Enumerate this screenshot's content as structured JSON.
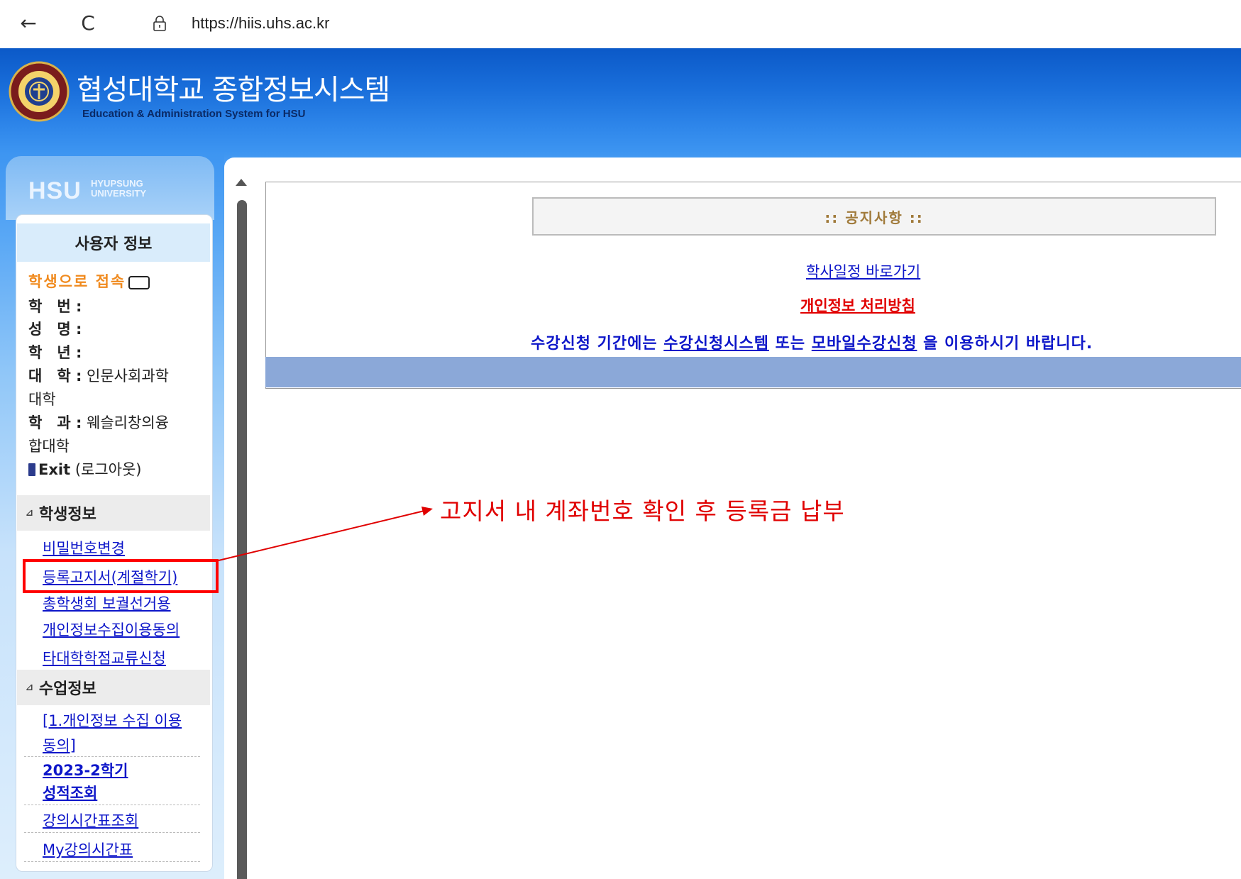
{
  "browser": {
    "url": "https://hiis.uhs.ac.kr",
    "back_icon": "←",
    "reload_icon": "C"
  },
  "header": {
    "title": "협성대학교 종합정보시스템",
    "subtitle": "Education & Administration System for HSU",
    "colors": {
      "primary": "#1a6fdb",
      "subtitle": "#0a2a66"
    }
  },
  "sidebar": {
    "hsu_logo": {
      "main": "HSU",
      "line1": "HYUPSUNG",
      "line2": "UNIVERSITY"
    },
    "user_info": {
      "heading": "사용자 정보",
      "login_status": "학생으로 접속",
      "fields": [
        {
          "label": "학　번 :",
          "value": ""
        },
        {
          "label": "성　명 :",
          "value": ""
        },
        {
          "label": "학　년 :",
          "value": ""
        },
        {
          "label": "대　학 :",
          "value": "인문사회과학",
          "value_cont": "대학"
        },
        {
          "label": "학　과 :",
          "value": "웨슬리창의융",
          "value_cont": "합대학"
        }
      ],
      "exit_label": "Exit",
      "logout_label": "(로그아웃)"
    },
    "student_info": {
      "heading": "학생정보",
      "items": [
        "비밀번호변경",
        "등록고지서(계절학기)",
        "총학생회 보궐선거용",
        "개인정보수집이용동의",
        "타대학학점교류신청"
      ]
    },
    "class_info": {
      "heading": "수업정보",
      "items": [
        "[1.개인정보 수집 이용",
        "동의]",
        "2023-2학기",
        "성적조회",
        "강의시간표조회",
        "My강의시간표"
      ]
    }
  },
  "notice": {
    "title": ":: 공지사항 ::",
    "schedule_link": "학사일정 바로가기",
    "privacy_link": "개인정보 처리방침",
    "line_part1": "수강신청 기간에는 ",
    "link_register": "수강신청시스템",
    "line_part2": " 또는 ",
    "link_mobile": "모바일수강신청",
    "line_part3": " 을 이용하시기 바랍니다."
  },
  "annotation": {
    "text": "고지서 내 계좌번호 확인 후 등록금 납부",
    "color": "#e00000"
  }
}
